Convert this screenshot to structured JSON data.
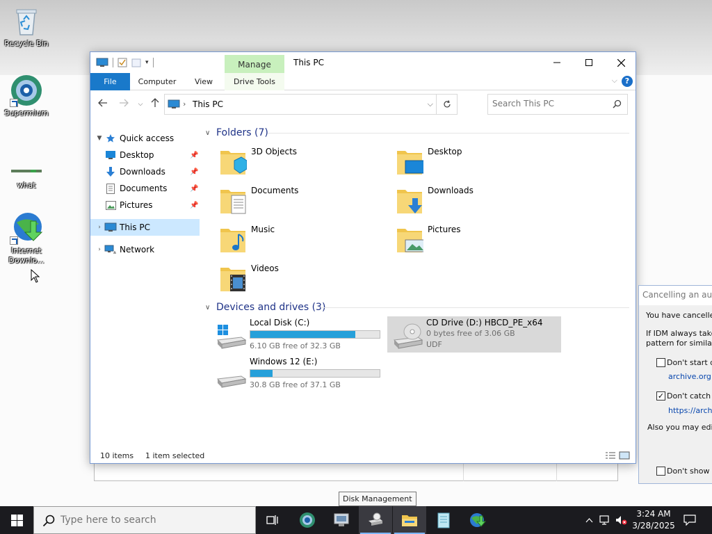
{
  "desktop": {
    "icons": [
      {
        "label": "Recycle Bin"
      },
      {
        "label": "Supermium"
      },
      {
        "label": "what"
      },
      {
        "label": "Internet Downlo..."
      }
    ]
  },
  "explorer": {
    "title": "This PC",
    "contextual_tab": "Manage",
    "ribbon_tabs": [
      "File",
      "Computer",
      "View",
      "Drive Tools"
    ],
    "address": "This PC",
    "search_placeholder": "Search This PC",
    "nav": {
      "quick_access": "Quick access",
      "pinned": [
        "Desktop",
        "Downloads",
        "Documents",
        "Pictures"
      ],
      "this_pc": "This PC",
      "network": "Network"
    },
    "folders_header": "Folders (7)",
    "folders": [
      "3D Objects",
      "Desktop",
      "Documents",
      "Downloads",
      "Music",
      "Pictures",
      "Videos"
    ],
    "drives_header": "Devices and drives (3)",
    "drives": [
      {
        "name": "Local Disk (C:)",
        "free": "6.10 GB free of 32.3 GB",
        "used_fraction": 0.81
      },
      {
        "name": "CD Drive (D:) HBCD_PE_x64",
        "free": "0 bytes free of 3.06 GB",
        "fs": "UDF"
      },
      {
        "name": "Windows 12 (E:)",
        "free": "30.8 GB free of 37.1 GB",
        "used_fraction": 0.17
      }
    ],
    "status": {
      "items": "10 items",
      "selected": "1 item selected"
    }
  },
  "idm_dialog": {
    "title": "Cancelling an autom",
    "line1": "You have cancelled",
    "line2": "If IDM always takes",
    "line3": "pattern for similar ad",
    "option1": "Don't start do",
    "option1_link": "archive.org",
    "option2": "Don't catch do",
    "option2_link": "https://archiv",
    "edit_text": "Also you may edit e",
    "dont_show": "Don't show th"
  },
  "tooltip": "Disk Management",
  "taskbar": {
    "search_placeholder": "Type here to search",
    "time": "3:24 AM",
    "date": "3/28/2025"
  },
  "colors": {
    "accent": "#1979ca",
    "selection": "#cce8ff",
    "progress": "#26a0da",
    "group_header": "#1e3287",
    "manage_tab": "#c8f0bd"
  }
}
